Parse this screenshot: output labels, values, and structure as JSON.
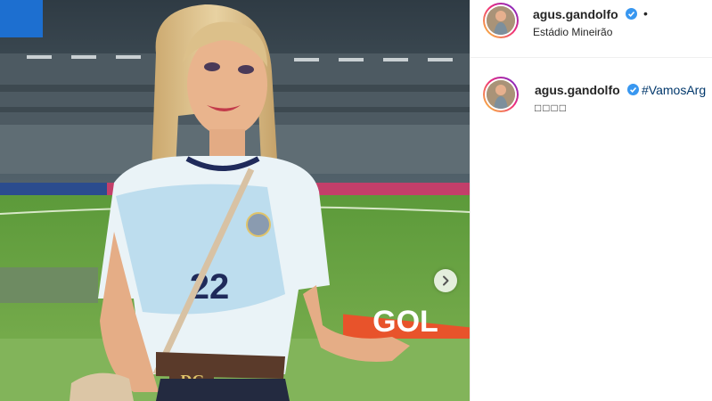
{
  "post": {
    "username": "agus.gandolfo",
    "location": "Estádio Mineirão",
    "separator": "•",
    "caption": {
      "username": "agus.gandolfo",
      "hashtag": "#VamosArg",
      "second_line": "□□□□"
    },
    "photo": {
      "jersey_number": "22",
      "banner_text": "GOL",
      "belt_text": "DG"
    }
  },
  "icons": {
    "verified": "verified-badge-icon",
    "next": "chevron-right-icon"
  },
  "colors": {
    "verified_blue": "#3897f0",
    "hashtag_blue": "#00376b",
    "text": "#262626",
    "banner_orange": "#e8532b"
  }
}
